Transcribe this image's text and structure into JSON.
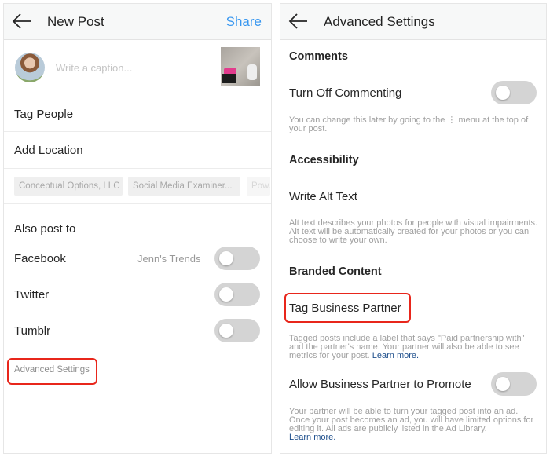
{
  "new_post": {
    "title": "New Post",
    "share_label": "Share",
    "caption_placeholder": "Write a caption...",
    "tag_people": "Tag People",
    "add_location": "Add Location",
    "location_chips": [
      "Conceptual Options, LLC",
      "Social Media Examiner...",
      "Pow..."
    ],
    "also_post_to": "Also post to",
    "networks": [
      {
        "label": "Facebook",
        "account": "Jenn's Trends",
        "enabled": false
      },
      {
        "label": "Twitter",
        "enabled": false
      },
      {
        "label": "Tumblr",
        "enabled": false
      }
    ],
    "advanced_settings": "Advanced Settings"
  },
  "advanced": {
    "title": "Advanced Settings",
    "comments_heading": "Comments",
    "turn_off_commenting": "Turn Off Commenting",
    "turn_off_commenting_enabled": false,
    "comments_help": "You can change this later by going to the ⋮ menu at the top of your post.",
    "accessibility_heading": "Accessibility",
    "write_alt_text": "Write Alt Text",
    "alt_help": "Alt text describes your photos for people with visual impairments. Alt text will be automatically created for your photos or you can choose to write your own.",
    "branded_heading": "Branded Content",
    "tag_business_partner": "Tag Business Partner",
    "tag_help": "Tagged posts include a label that says \"Paid partnership with\" and the partner's name. Your partner will also be able to see metrics for your post.",
    "learn_more": "Learn more.",
    "allow_promote": "Allow Business Partner to Promote",
    "allow_promote_enabled": false,
    "promote_help": "Your partner will be able to turn your tagged post into an ad. Once your post becomes an ad, you will have limited options for editing it. All ads are publicly listed in the Ad Library.",
    "highlight_color": "#e8261b",
    "accent_color": "#3897f0"
  }
}
